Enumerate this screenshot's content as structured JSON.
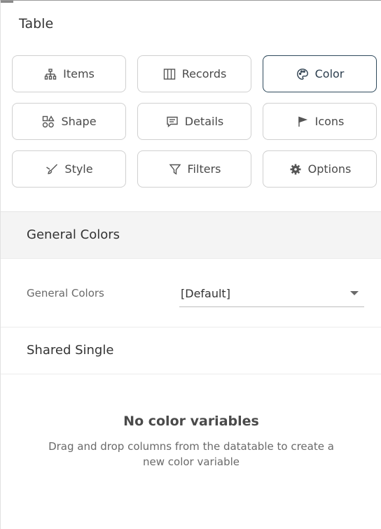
{
  "panel": {
    "title": "Table"
  },
  "tabs": [
    {
      "label": "Items",
      "icon": "hierarchy-icon",
      "active": false
    },
    {
      "label": "Records",
      "icon": "columns-icon",
      "active": false
    },
    {
      "label": "Color",
      "icon": "palette-icon",
      "active": true
    },
    {
      "label": "Shape",
      "icon": "shapes-icon",
      "active": false
    },
    {
      "label": "Details",
      "icon": "comment-icon",
      "active": false
    },
    {
      "label": "Icons",
      "icon": "flag-icon",
      "active": false
    },
    {
      "label": "Style",
      "icon": "brush-icon",
      "active": false
    },
    {
      "label": "Filters",
      "icon": "filter-icon",
      "active": false
    },
    {
      "label": "Options",
      "icon": "gear-icon",
      "active": false
    }
  ],
  "general_colors": {
    "section_title": "General Colors",
    "field_label": "General Colors",
    "selected_value": "[Default]"
  },
  "shared_single": {
    "title": "Shared Single"
  },
  "empty_state": {
    "title": "No color variables",
    "description": "Drag and drop columns from the datatable to create a new color variable"
  },
  "colors": {
    "active_border": "#2f4a5c",
    "section_bg": "#f4f4f4"
  }
}
